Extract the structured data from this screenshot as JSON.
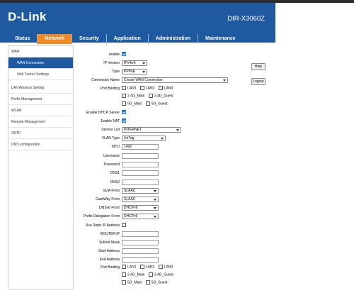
{
  "header": {
    "logo": "D-Link",
    "model": "DIR-X3060Z"
  },
  "nav": [
    "Status",
    "Network",
    "Security",
    "Application",
    "Administration",
    "Maintenance"
  ],
  "sidebar": {
    "wan": "WAN",
    "wan_connection": "WAN Connection",
    "tunnel": "4in6 Tunnel Settings",
    "lan": "LAN Address Setting",
    "prefix": "Prefix Management",
    "wlan": "WLAN",
    "remote": "Remote Management",
    "sntp": "SNTP",
    "dns": "DNS configuration"
  },
  "buttons": {
    "help": "Help",
    "logout": "Logout"
  },
  "form": {
    "enable": "enable",
    "ip_version_label": "IP Version",
    "ip_version": "IPv4/v6",
    "type_label": "Type",
    "type": "PPPoE",
    "conn_name_label": "Connection Name",
    "conn_name": "Create WAN Connection",
    "port_binding_label": "Port Binding",
    "ports1": [
      "LAN1",
      "LAN2",
      "LAN3"
    ],
    "ports2": [
      "2.4G_Main",
      "2.4G_Guest"
    ],
    "ports3": [
      "5G_Main",
      "5G_Guest"
    ],
    "dhcp_server": "Enable DHCP Server",
    "nat": "Enable NAT",
    "service_list_label": "Service List",
    "service_list": "INTERNET",
    "vlan_type_label": "VLAN Type",
    "vlan_type": "UnTag",
    "mtu_label": "MTU",
    "mtu": "1492",
    "username": "Username",
    "password": "Password",
    "dns1": "DNS1",
    "dns2": "DNS2",
    "gua_label": "GUA From",
    "gua": "SLAAC",
    "gateway_label": "GateWay From",
    "gateway": "SLAAC",
    "dnsv6_label": "DNSv6 From",
    "dnsv6": "DHCPv6",
    "prefix_deleg_label": "Prefix Delegation From",
    "prefix_deleg": "DHCPv6",
    "static_ip": "Use Static IP Address",
    "router_ip": "ROUTER IP",
    "subnet": "Subnet Mask",
    "start": "Start Address",
    "end": "End Address",
    "port_binding2_label": "Port Binding"
  }
}
